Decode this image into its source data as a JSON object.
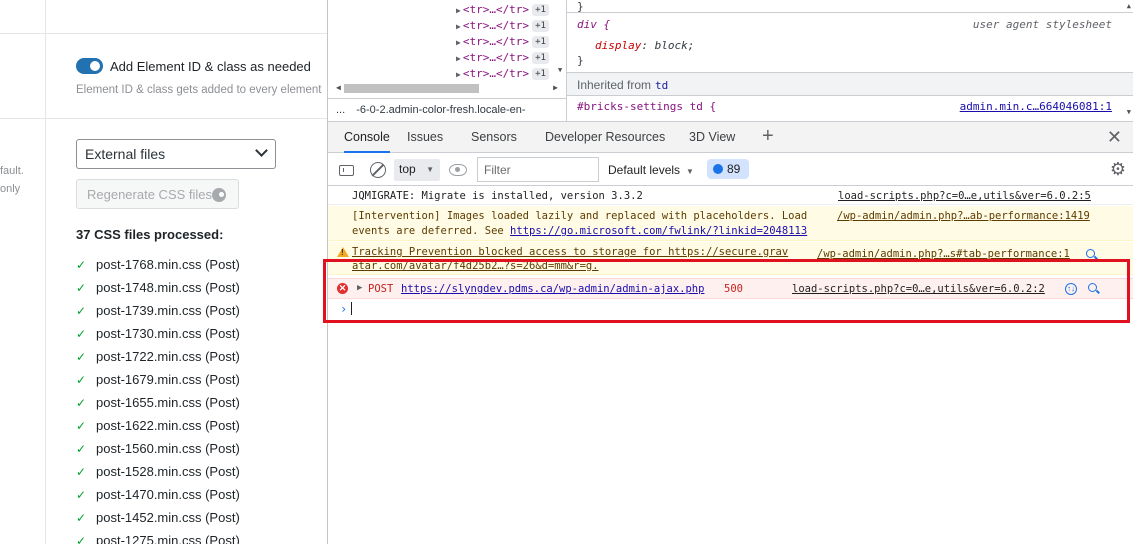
{
  "left_panel": {
    "toggle_label": "Add Element ID & class as needed",
    "toggle_hint": "Element ID & class gets added to every element",
    "side_text_1": "fault.",
    "side_text_2": "only",
    "css_loading_select": "External files",
    "regenerate_button": "Regenerate CSS files",
    "processed_title": "37 CSS files processed:",
    "check_glyph": "✓",
    "files": [
      "post-1768.min.css (Post)",
      "post-1748.min.css (Post)",
      "post-1739.min.css (Post)",
      "post-1730.min.css (Post)",
      "post-1722.min.css (Post)",
      "post-1679.min.css (Post)",
      "post-1655.min.css (Post)",
      "post-1622.min.css (Post)",
      "post-1560.min.css (Post)",
      "post-1528.min.css (Post)",
      "post-1470.min.css (Post)",
      "post-1452.min.css (Post)",
      "post-1275.min.css (Post)"
    ]
  },
  "devtools": {
    "dom_rows": [
      {
        "tag": "<tr>…</tr>",
        "badge": "+1"
      },
      {
        "tag": "<tr>…</tr>",
        "badge": "+1"
      },
      {
        "tag": "<tr>…</tr>",
        "badge": "+1"
      },
      {
        "tag": "<tr>…</tr>",
        "badge": "+1"
      },
      {
        "tag": "<tr>…</tr>",
        "badge": "+1"
      }
    ],
    "breadcrumb_dots": "...",
    "breadcrumb": "-6-0-2.admin-color-fresh.locale-en-",
    "styles": {
      "brace_close": "}",
      "rule_selector": "div {",
      "rule_source": "user agent stylesheet",
      "decl_prop": "display",
      "decl_value": "block;",
      "inherited_label": "Inherited from",
      "inherited_el": "td",
      "rule2_selector": "#bricks-settings td {",
      "rule2_source": "admin.min.c…664046081:1"
    },
    "tabs": [
      "Console",
      "Issues",
      "Sensors",
      "Developer Resources",
      "3D View"
    ],
    "active_tab": "Console",
    "toolbar": {
      "context": "top",
      "filter_placeholder": "Filter",
      "levels": "Default levels",
      "message_count": "89"
    },
    "messages": {
      "jqmigrate_text": "JQMIGRATE: Migrate is installed, version 3.3.2",
      "jqmigrate_src": "load-scripts.php?c=0…e,utils&ver=6.0.2:5",
      "intervention_line1": "[Intervention] Images loaded lazily and replaced with placeholders. Load",
      "intervention_line2_prefix": "events are deferred. See",
      "intervention_link": "https://go.microsoft.com/fwlink/?linkid=2048113",
      "intervention_src": "/wp-admin/admin.php?…ab-performance:1419",
      "tracking_line1": "Tracking Prevention blocked access to storage for https://secure.grav",
      "tracking_line2": "atar.com/avatar/f4d25b2…?s=26&d=mm&r=g.",
      "tracking_src": "/wp-admin/admin.php?…s#tab-performance:1",
      "error_method": "POST",
      "error_url": "https://slyngdev.pdms.ca/wp-admin/admin-ajax.php",
      "error_status": "500",
      "error_src": "load-scripts.php?c=0…e,utils&ver=6.0.2:2",
      "prompt": "›"
    }
  },
  "colors": {
    "highlight": "#e0121f",
    "toggle": "#2271b1",
    "check": "#00a32a",
    "error_text": "#c5221f"
  }
}
